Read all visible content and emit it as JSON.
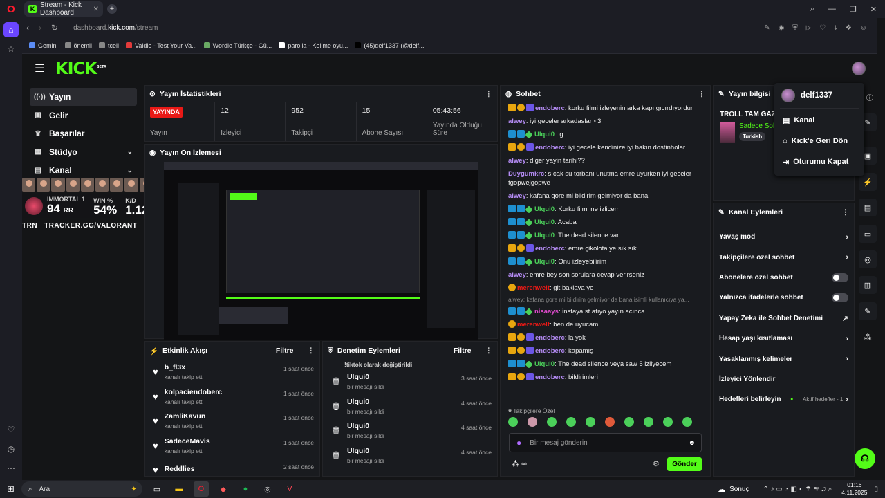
{
  "browser": {
    "tab_title": "Stream - Kick Dashboard",
    "url_prefix": "dashboard.",
    "url_domain": "kick.com",
    "url_path": "/stream",
    "bookmarks": [
      {
        "label": "Gemini",
        "color": "#5b8cf5"
      },
      {
        "label": "önemli",
        "color": "#888888"
      },
      {
        "label": "tcell",
        "color": "#888888"
      },
      {
        "label": "Valdle - Test Your Va...",
        "color": "#e33b3b"
      },
      {
        "label": "Wordle Türkçe - Gü...",
        "color": "#6aaa64"
      },
      {
        "label": "parolla - Kelime oyu...",
        "color": "#ffffff"
      },
      {
        "label": "(45)delf1337 (@delf...",
        "color": "#000000"
      }
    ]
  },
  "kick": {
    "logo": "KICK",
    "logo_sup": "BETA",
    "nav": [
      {
        "label": "Yayın",
        "icon": "broadcast-icon"
      },
      {
        "label": "Gelir",
        "icon": "wallet-icon"
      },
      {
        "label": "Başarılar",
        "icon": "trophy-icon"
      },
      {
        "label": "Stüdyo",
        "icon": "studio-icon"
      },
      {
        "label": "Kanal",
        "icon": "channel-icon"
      }
    ]
  },
  "stats_panel": {
    "title": "Yayın İstatistikleri",
    "live_badge": "YAYINDA",
    "items": [
      {
        "value": "",
        "label": "Yayın"
      },
      {
        "value": "12",
        "label": "İzleyici"
      },
      {
        "value": "952",
        "label": "Takipçi"
      },
      {
        "value": "15",
        "label": "Abone Sayısı"
      },
      {
        "value": "05:43:56",
        "label": "Yayında Olduğu Süre"
      }
    ]
  },
  "preview_panel": {
    "title": "Yayın Ön İzlemesi"
  },
  "overlay": {
    "rank_label": "IMMORTAL 1",
    "rank_value": "94",
    "rank_unit": "RR",
    "win_label": "WIN %",
    "win_value": "54%",
    "kd_label": "K/D",
    "kd_value": "1.12",
    "trn": "TRN",
    "tracker": "TRACKER.GG/VALORANT"
  },
  "activity": {
    "title": "Etkinlik Akışı",
    "filter": "Filtre",
    "items": [
      {
        "name": "b_fl3x",
        "sub": "kanalı takip etti",
        "time": "1 saat önce"
      },
      {
        "name": "kolpaciendoberc",
        "sub": "kanalı takip etti",
        "time": "1 saat önce"
      },
      {
        "name": "ZamliKavun",
        "sub": "kanalı takip etti",
        "time": "1 saat önce"
      },
      {
        "name": "SadeceMavis",
        "sub": "kanalı takip etti",
        "time": "1 saat önce"
      },
      {
        "name": "Reddlies",
        "sub": "",
        "time": "2 saat önce"
      }
    ]
  },
  "moderation": {
    "title": "Denetim Eylemleri",
    "filter": "Filtre",
    "partial": "!tiktok olarak değiştirildi",
    "items": [
      {
        "name": "Ulqui0",
        "sub": "bir mesajı sildi",
        "time": "3 saat önce"
      },
      {
        "name": "Ulqui0",
        "sub": "bir mesajı sildi",
        "time": "4 saat önce"
      },
      {
        "name": "Ulqui0",
        "sub": "bir mesajı sildi",
        "time": "4 saat önce"
      },
      {
        "name": "Ulqui0",
        "sub": "bir mesajı sildi",
        "time": "4 saat önce"
      }
    ]
  },
  "chat": {
    "title": "Sohbet",
    "messages": [
      {
        "user": "endoberc",
        "color": "#b58cf5",
        "badges": [
          "vip",
          "sub",
          "mod"
        ],
        "text": "korku filmi izleyenin arka kapı gıcırdıyordur"
      },
      {
        "user": "alwey",
        "color": "#b58cf5",
        "badges": [],
        "text": "iyi geceler arkadaslar <3"
      },
      {
        "user": "Ulqui0",
        "color": "#4bd05a",
        "badges": [
          "rr",
          "rr",
          "gg"
        ],
        "text": "ig"
      },
      {
        "user": "endoberc",
        "color": "#b58cf5",
        "badges": [
          "vip",
          "sub",
          "mod"
        ],
        "text": "iyi gecele kendinize iyi bakın dostinholar"
      },
      {
        "user": "alwey",
        "color": "#b58cf5",
        "badges": [],
        "text": "diger yayin tarihi??"
      },
      {
        "user": "Duygumkrc",
        "color": "#b58cf5",
        "badges": [],
        "text": "sıcak su torbanı unutma emre uyurken iyi geceler fgopwejgopwe"
      },
      {
        "user": "alwey",
        "color": "#b58cf5",
        "badges": [],
        "text": "kafana gore mi bildirim gelmiyor da bana"
      },
      {
        "user": "Ulqui0",
        "color": "#4bd05a",
        "badges": [
          "rr",
          "rr",
          "gg"
        ],
        "text": "Korku filmi ne izlicem"
      },
      {
        "user": "Ulqui0",
        "color": "#4bd05a",
        "badges": [
          "rr",
          "rr",
          "gg"
        ],
        "text": "Acaba"
      },
      {
        "user": "Ulqui0",
        "color": "#4bd05a",
        "badges": [
          "rr",
          "rr",
          "gg"
        ],
        "text": "The dead silence var"
      },
      {
        "user": "endoberc",
        "color": "#b58cf5",
        "badges": [
          "vip",
          "sub",
          "mod"
        ],
        "text": "emre çikolota ye sık sık"
      },
      {
        "user": "Ulqui0",
        "color": "#4bd05a",
        "badges": [
          "rr",
          "rr",
          "gg"
        ],
        "text": "Onu izleyebilirim"
      },
      {
        "user": "alwey",
        "color": "#b58cf5",
        "badges": [],
        "text": "emre bey son sorulara cevap verirseniz"
      },
      {
        "user": "merenwelt",
        "color": "#e91916",
        "badges": [
          "sub"
        ],
        "text": "git baklava ye"
      },
      {
        "user": "nisaays",
        "color": "#e24bd0",
        "badges": [
          "rr",
          "rr",
          "gg"
        ],
        "text": "instaya st atıyo yayın acınca",
        "reply": "alwey: kafana gore mi bildirim gelmiyor da bana isimli kullanıcıya ya..."
      },
      {
        "user": "merenwelt",
        "color": "#e91916",
        "badges": [
          "sub"
        ],
        "text": "ben de uyucam"
      },
      {
        "user": "endoberc",
        "color": "#b58cf5",
        "badges": [
          "vip",
          "sub",
          "mod"
        ],
        "text": "la yok"
      },
      {
        "user": "endoberc",
        "color": "#b58cf5",
        "badges": [
          "vip",
          "sub",
          "mod"
        ],
        "text": "kapamış"
      },
      {
        "user": "Ulqui0",
        "color": "#4bd05a",
        "badges": [
          "rr",
          "rr",
          "gg"
        ],
        "text": "The dead silence veya saw 5 izliyecem"
      },
      {
        "user": "endoberc",
        "color": "#b58cf5",
        "badges": [
          "vip",
          "sub",
          "mod"
        ],
        "text": "bildirimleri"
      }
    ],
    "follower_only": "Takipçilere Özel",
    "placeholder": "Bir mesaj gönderin",
    "send": "Gönder"
  },
  "stream_info": {
    "title": "Yayın bilgisi",
    "stream_title": "TROLL TAM GAZ",
    "category": "Sadece Sol",
    "tag": "Turkish"
  },
  "channel_actions": {
    "title": "Kanal Eylemleri",
    "items": [
      {
        "label": "Yavaş mod",
        "kind": "chevron",
        "extra": ""
      },
      {
        "label": "Takipçilere özel sohbet",
        "kind": "chevron",
        "extra": ""
      },
      {
        "label": "Abonelere özel sohbet",
        "kind": "toggle",
        "extra": ""
      },
      {
        "label": "Yalnızca ifadelerle sohbet",
        "kind": "toggle",
        "extra": ""
      },
      {
        "label": "Yapay Zeka ile Sohbet Denetimi",
        "kind": "external",
        "extra": ""
      },
      {
        "label": "Hesap yaşı kısıtlaması",
        "kind": "chevron",
        "extra": ""
      },
      {
        "label": "Yasaklanmış kelimeler",
        "kind": "chevron",
        "extra": ""
      },
      {
        "label": "İzleyici Yönlendir",
        "kind": "none",
        "extra": ""
      },
      {
        "label": "Hedefleri belirleyin",
        "kind": "chevron",
        "extra": "Aktif hedefler - 1"
      }
    ]
  },
  "user_menu": {
    "username": "delf1337",
    "items": [
      {
        "label": "Kanal",
        "icon": "channel-icon"
      },
      {
        "label": "Kick'e Geri Dön",
        "icon": "home-icon"
      },
      {
        "label": "Oturumu Kapat",
        "icon": "logout-icon"
      }
    ]
  },
  "taskbar": {
    "search": "Ara",
    "weather": "Sonuç",
    "time": "01:16",
    "date": "4.11.2025"
  }
}
